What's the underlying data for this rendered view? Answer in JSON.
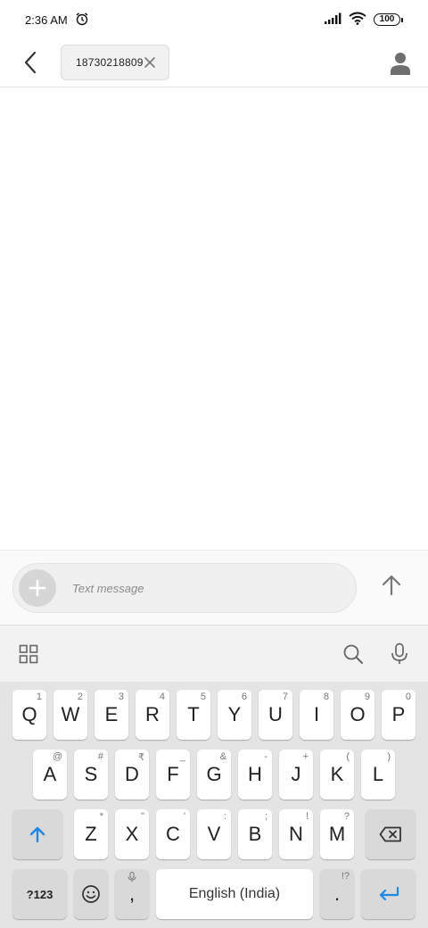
{
  "status_bar": {
    "time": "2:36 AM",
    "battery": "100"
  },
  "header": {
    "recipient": "18730218809"
  },
  "compose": {
    "placeholder": "Text message"
  },
  "keyboard": {
    "row1": [
      {
        "key": "Q",
        "hint": "1"
      },
      {
        "key": "W",
        "hint": "2"
      },
      {
        "key": "E",
        "hint": "3"
      },
      {
        "key": "R",
        "hint": "4"
      },
      {
        "key": "T",
        "hint": "5"
      },
      {
        "key": "Y",
        "hint": "6"
      },
      {
        "key": "U",
        "hint": "7"
      },
      {
        "key": "I",
        "hint": "8"
      },
      {
        "key": "O",
        "hint": "9"
      },
      {
        "key": "P",
        "hint": "0"
      }
    ],
    "row2": [
      {
        "key": "A",
        "hint": "@"
      },
      {
        "key": "S",
        "hint": "#"
      },
      {
        "key": "D",
        "hint": "₹"
      },
      {
        "key": "F",
        "hint": "_"
      },
      {
        "key": "G",
        "hint": "&"
      },
      {
        "key": "H",
        "hint": "-"
      },
      {
        "key": "J",
        "hint": "+"
      },
      {
        "key": "K",
        "hint": "("
      },
      {
        "key": "L",
        "hint": ")"
      }
    ],
    "row3": [
      {
        "key": "Z",
        "hint": "*"
      },
      {
        "key": "X",
        "hint": "\""
      },
      {
        "key": "C",
        "hint": "'"
      },
      {
        "key": "V",
        "hint": ":"
      },
      {
        "key": "B",
        "hint": ";"
      },
      {
        "key": "N",
        "hint": "!"
      },
      {
        "key": "M",
        "hint": "?"
      }
    ],
    "symbols_label": "?123",
    "comma": ",",
    "space_label": "English (India)",
    "period": ".",
    "period_hint": "!?"
  },
  "colors": {
    "accent": "#1e88e5",
    "icon_gray": "#6f6f6f"
  }
}
